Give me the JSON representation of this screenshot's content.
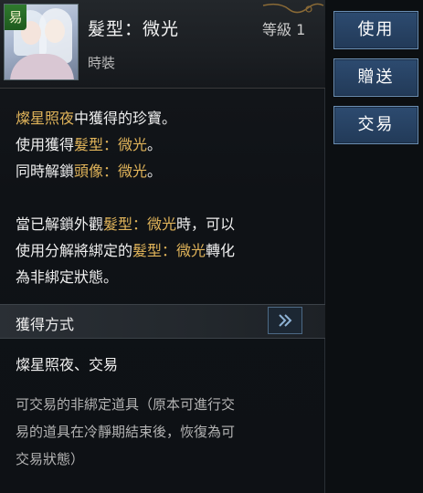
{
  "item": {
    "trade_badge": "易",
    "title": "髮型：微光",
    "level": "等級 1",
    "subtype": "時裝"
  },
  "description": {
    "line1_gold": "燦星照夜",
    "line1_rest": "中獲得的珍寶。",
    "line2_pre": "使用獲得",
    "line2_gold": "髮型：微光",
    "line2_post": "。",
    "line3_pre": "同時解鎖",
    "line3_gold": "頭像：微光",
    "line3_post": "。",
    "line4_pre": "當已解鎖外觀",
    "line4_gold": "髮型：微光",
    "line4_post": "時，可以",
    "line5_pre": "使用分解將綁定的",
    "line5_gold": "髮型：微光",
    "line5_post": "轉化",
    "line6": "為非綁定狀態。"
  },
  "acquisition": {
    "header": "獲得方式",
    "text": "燦星照夜、交易"
  },
  "note": {
    "line1": "可交易的非綁定道具（原本可進行交",
    "line2": "易的道具在冷靜期結束後，恢復為可",
    "line3": "交易狀態）"
  },
  "actions": {
    "use": "使用",
    "gift": "贈送",
    "trade": "交易"
  },
  "colors": {
    "accent_gold": "#e1b45a",
    "button_blue": "#2d4b70",
    "trade_badge_green": "#2f7a2e"
  },
  "icons": {
    "arrow": "double-chevron-right-icon"
  }
}
